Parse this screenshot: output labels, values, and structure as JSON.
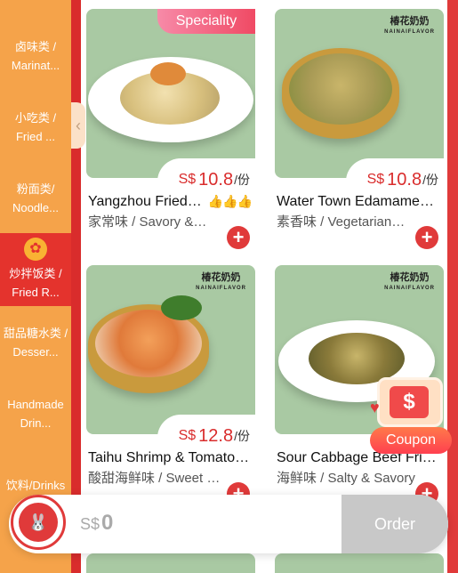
{
  "sidebar": {
    "categories": [
      {
        "line1": "卤味类 /",
        "line2": "Marinat..."
      },
      {
        "line1": "小吃类 /",
        "line2": "Fried ..."
      },
      {
        "line1": "粉面类/",
        "line2": "Noodle..."
      },
      {
        "line1": "炒拌饭类 /",
        "line2": "Fried R...",
        "active": true
      },
      {
        "line1": "甜品糖水类 /",
        "line2": "Desser..."
      },
      {
        "line1": "Handmade",
        "line2": "Drin..."
      },
      {
        "line1": "饮料/Drinks",
        "line2": ""
      }
    ],
    "collapse_icon": "chevron-left-icon"
  },
  "products": [
    {
      "name": "Yangzhou Fried…",
      "desc": "家常味 / Savory &…",
      "currency": "S$",
      "price": "10.8",
      "unit": "/份",
      "badge": "Speciality",
      "thumbs": "👍👍👍"
    },
    {
      "name": "Water Town Edamame,…",
      "desc": "素香味 / Vegetarian…",
      "currency": "S$",
      "price": "10.8",
      "unit": "/份",
      "brand": "椿花奶奶",
      "brand_sub": "NAINAIFLAVOR"
    },
    {
      "name": "Taihu Shrimp & Tomato…",
      "desc": "酸甜海鲜味 / Sweet &…",
      "currency": "S$",
      "price": "12.8",
      "unit": "/份",
      "brand": "椿花奶奶",
      "brand_sub": "NAINAIFLAVOR"
    },
    {
      "name": "Sour Cabbage Beef Fri…",
      "desc": "海鲜味 / Salty & Savory",
      "currency": "S$",
      "price": "",
      "unit": "",
      "brand": "椿花奶奶",
      "brand_sub": "NAINAIFLAVOR"
    }
  ],
  "coupon": {
    "label": "Coupon",
    "symbol": "$"
  },
  "cart": {
    "currency": "S$",
    "total": "0",
    "order_label": "Order"
  },
  "colors": {
    "sidebar": "#f5a34a",
    "active": "#e4332d",
    "accent": "#e03a3a",
    "card_bg": "#a9c9a3"
  }
}
